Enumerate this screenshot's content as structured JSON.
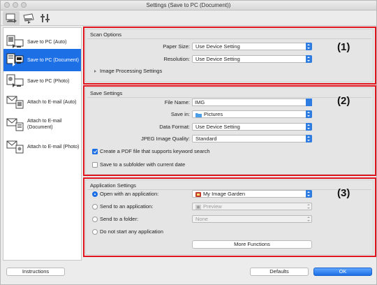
{
  "window": {
    "title": "Settings (Save to PC (Document))"
  },
  "toolbar": [
    {
      "name": "scan-from-computer-tab",
      "icon": "computer-scan-icon"
    },
    {
      "name": "scan-from-operation-panel-tab",
      "icon": "scanner-panel-icon"
    },
    {
      "name": "general-settings-tab",
      "icon": "tools-icon"
    }
  ],
  "sidebar": {
    "items": [
      {
        "label": "Save to PC (Auto)",
        "icon": "save-auto-icon"
      },
      {
        "label": "Save to PC (Document)",
        "icon": "save-document-icon"
      },
      {
        "label": "Save to PC (Photo)",
        "icon": "save-photo-icon"
      },
      {
        "label": "Attach to E-mail (Auto)",
        "icon": "email-auto-icon"
      },
      {
        "label": "Attach to E-mail (Document)",
        "icon": "email-document-icon"
      },
      {
        "label": "Attach to E-mail (Photo)",
        "icon": "email-photo-icon"
      }
    ]
  },
  "scan_options": {
    "title": "Scan Options",
    "number": "(1)",
    "paper_size_label": "Paper Size:",
    "paper_size_value": "Use Device Setting",
    "resolution_label": "Resolution:",
    "resolution_value": "Use Device Setting",
    "image_processing_label": "Image Processing Settings"
  },
  "save_settings": {
    "title": "Save Settings",
    "number": "(2)",
    "file_name_label": "File Name:",
    "file_name_value": "IMG",
    "save_in_label": "Save in:",
    "save_in_value": "Pictures",
    "data_format_label": "Data Format:",
    "data_format_value": "Use Device Setting",
    "jpeg_quality_label": "JPEG Image Quality:",
    "jpeg_quality_value": "Standard",
    "create_pdf_label": "Create a PDF file that supports keyword search",
    "subfolder_label": "Save to a subfolder with current date"
  },
  "app_settings": {
    "title": "Application Settings",
    "number": "(3)",
    "open_app_label": "Open with an application:",
    "open_app_value": "My Image Garden",
    "send_app_label": "Send to an application:",
    "send_app_value": "Preview",
    "send_folder_label": "Send to a folder:",
    "send_folder_value": "None",
    "no_app_label": "Do not start any application",
    "more_functions_label": "More Functions"
  },
  "footer": {
    "instructions_label": "Instructions",
    "defaults_label": "Defaults",
    "ok_label": "OK"
  },
  "colors": {
    "accent": "#1d6fe6",
    "highlight_box": "#e0141e"
  }
}
